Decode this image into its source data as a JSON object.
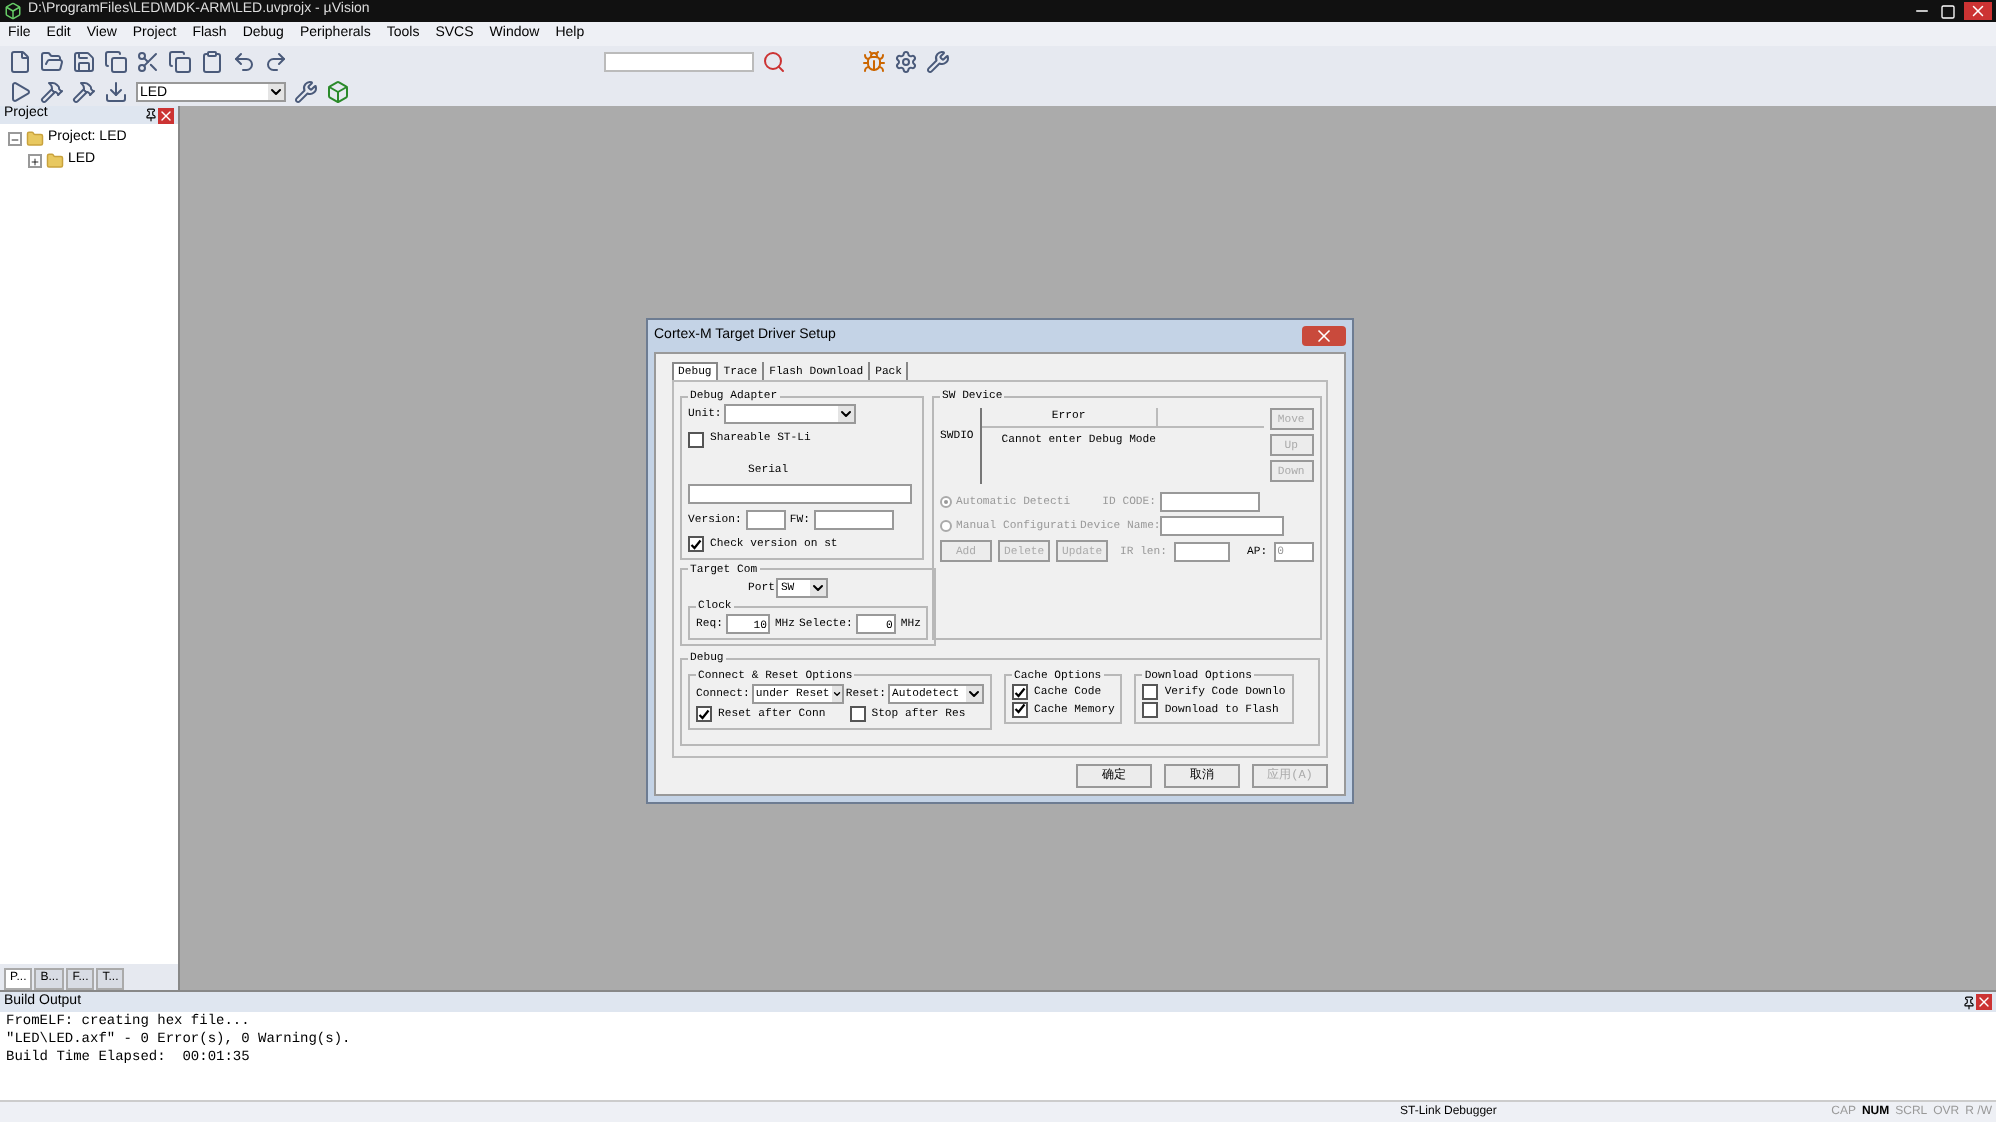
{
  "window": {
    "title": "D:\\ProgramFiles\\LED\\MDK-ARM\\LED.uvprojx - µVision"
  },
  "menu": [
    "File",
    "Edit",
    "View",
    "Project",
    "Flash",
    "Debug",
    "Peripherals",
    "Tools",
    "SVCS",
    "Window",
    "Help"
  ],
  "toolbar": {
    "target": "LED"
  },
  "project_panel": {
    "title": "Project",
    "tree": [
      {
        "label": "Project: LED",
        "expanded": true,
        "children": [
          {
            "label": "LED",
            "expanded": false
          }
        ]
      }
    ],
    "tabs": [
      {
        "label": "P...",
        "selected": true
      },
      {
        "label": "B...",
        "selected": false
      },
      {
        "label": "F...",
        "selected": false
      },
      {
        "label": "T...",
        "selected": false
      }
    ]
  },
  "dialog": {
    "title": "Cortex-M Target Driver Setup",
    "tabs": [
      {
        "label": "Debug",
        "selected": true
      },
      {
        "label": "Trace",
        "selected": false
      },
      {
        "label": "Flash Download",
        "selected": false
      },
      {
        "label": "Pack",
        "selected": false
      }
    ],
    "debug_adapter": {
      "title": "Debug Adapter",
      "unit_label": "Unit:",
      "shareable": {
        "label": "Shareable ST-Li",
        "checked": false
      },
      "serial_label": "Serial",
      "version_label": "Version:",
      "fw_label": "FW:",
      "check_version": {
        "label": "Check version on st",
        "checked": true
      }
    },
    "target_com": {
      "title": "Target Com",
      "port_label": "Port",
      "port_value": "SW",
      "clock_title": "Clock",
      "req_label": "Req:",
      "req_value": "10",
      "req_unit": "MHz",
      "selected_label": "Selecte:",
      "selected_value": "0",
      "selected_unit": "MHz"
    },
    "sw_device": {
      "title": "SW Device",
      "row_label": "SWDIO",
      "column": "Error",
      "message": "Cannot enter Debug Mode",
      "side_buttons": [
        {
          "label": "Move",
          "disabled": true
        },
        {
          "label": "Up",
          "disabled": true
        },
        {
          "label": "Down",
          "disabled": true
        }
      ],
      "radios": [
        {
          "label": "Automatic Detecti",
          "selected": true
        },
        {
          "label": "Manual Configurati",
          "selected": false
        }
      ],
      "id_code_label": "ID CODE:",
      "device_name_label": "Device Name:",
      "buttons": [
        {
          "label": "Add",
          "disabled": true
        },
        {
          "label": "Delete",
          "disabled": true
        },
        {
          "label": "Update",
          "disabled": true
        }
      ],
      "ir_len_label": "IR len:",
      "ap_label": "AP:",
      "ap_value": "0"
    },
    "debug": {
      "title": "Debug",
      "connect_reset": {
        "title": "Connect & Reset Options",
        "connect_label": "Connect:",
        "connect_value": "under Reset",
        "reset_label": "Reset:",
        "reset_value": "Autodetect",
        "checks": [
          {
            "label": "Reset after Conn",
            "checked": true
          },
          {
            "label": "Stop after Res",
            "checked": false
          }
        ]
      },
      "cache": {
        "title": "Cache Options",
        "checks": [
          {
            "label": "Cache Code",
            "checked": true
          },
          {
            "label": "Cache Memory",
            "checked": true
          }
        ]
      },
      "download": {
        "title": "Download Options",
        "checks": [
          {
            "label": "Verify Code Downlo",
            "checked": false
          },
          {
            "label": "Download to Flash",
            "checked": false
          }
        ]
      }
    },
    "buttons": [
      {
        "label": "确定",
        "disabled": false
      },
      {
        "label": "取消",
        "disabled": false
      },
      {
        "label": "应用(A)",
        "disabled": true
      }
    ]
  },
  "build_output": {
    "title": "Build Output",
    "lines": [
      "FromELF: creating hex file...",
      "\"LED\\LED.axf\" - 0 Error(s), 0 Warning(s).",
      "Build Time Elapsed:  00:01:35"
    ]
  },
  "status_bar": {
    "debugger": "ST-Link Debugger",
    "indicators": [
      {
        "label": "CAP",
        "on": false
      },
      {
        "label": "NUM",
        "on": true
      },
      {
        "label": "SCRL",
        "on": false
      },
      {
        "label": "OVR",
        "on": false
      },
      {
        "label": "R /W",
        "on": false
      }
    ]
  }
}
